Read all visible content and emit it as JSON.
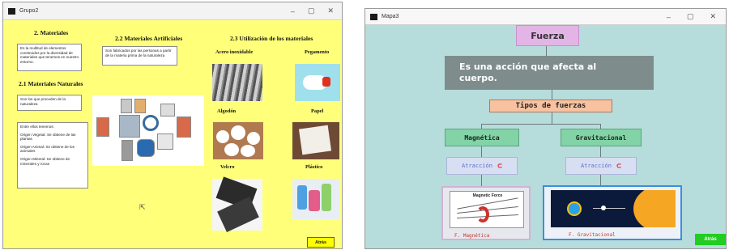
{
  "window1": {
    "title": "Grupo2",
    "section_2": {
      "heading": "2. Materiales",
      "text": "Es la multitud de elementos construidos por la diversidad de materiales que tenemos en nuestro entorno."
    },
    "section_21": {
      "heading": "2.1 Materiales Naturales",
      "text": "Son los que proceden de la naturaleza",
      "list": [
        "Entre ellos tenemos:",
        "Origen Vegetal: Se obtiene de las plantas",
        "Origen Animal: Se obtiene de los animales",
        "Origen Mineral: Se obtiene de minerales y rocas"
      ]
    },
    "section_22": {
      "heading": "2.2 Materiales Artificiales",
      "text": "Son fabricados por las personas a partir de la materia prima de la naturaleza"
    },
    "section_23": {
      "heading": "2.3 Utilización de los materiales",
      "items": [
        "Acero inoxidable",
        "Pegamento",
        "Algodón",
        "Papel",
        "Velcro",
        "Plástico"
      ]
    },
    "button_label": "Atrás",
    "accent_color": "#ffff7a"
  },
  "window2": {
    "title": "Mapa3",
    "root": "Fuerza",
    "definition": "Es una acción que afecta al cuerpo.",
    "types_header": "Tipos de fuerzas",
    "branches": [
      {
        "label": "Magnética",
        "sub": "Atracción",
        "caption": "F. Magnética",
        "image_title": "Magnetic Force"
      },
      {
        "label": "Gravitacional",
        "sub": "Atracción",
        "caption": "F. Gravitacional"
      }
    ],
    "button_label": "Atrás",
    "colors": {
      "background": "#b7dcdc",
      "root": "#e3b4e6",
      "definition": "#7f8c8c",
      "types": "#f8c2a0",
      "branch": "#82d4a6",
      "sub": "#d9dff2",
      "button": "#22cc22"
    }
  }
}
